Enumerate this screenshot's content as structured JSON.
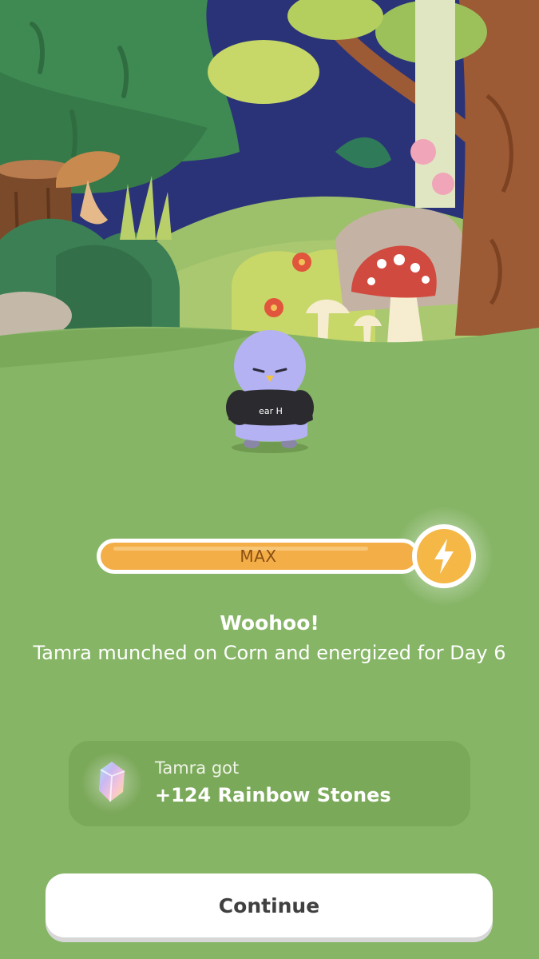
{
  "energy": {
    "label": "MAX",
    "level": 1.0,
    "icon": "lightning-bolt-icon",
    "fill_color": "#f4ae47",
    "badge_color": "#f5b846"
  },
  "message": {
    "title": "Woohoo!",
    "body": "Tamra munched on Corn and energized for Day 6"
  },
  "reward": {
    "label": "Tamra got",
    "value": "+124 Rainbow Stones",
    "icon": "rainbow-stone-icon"
  },
  "continue_label": "Continue",
  "pet": {
    "shirt_text": "ear H"
  },
  "colors": {
    "grass": "#86b566",
    "sky": "#2b3378",
    "reward_card": "#7ba95a"
  }
}
